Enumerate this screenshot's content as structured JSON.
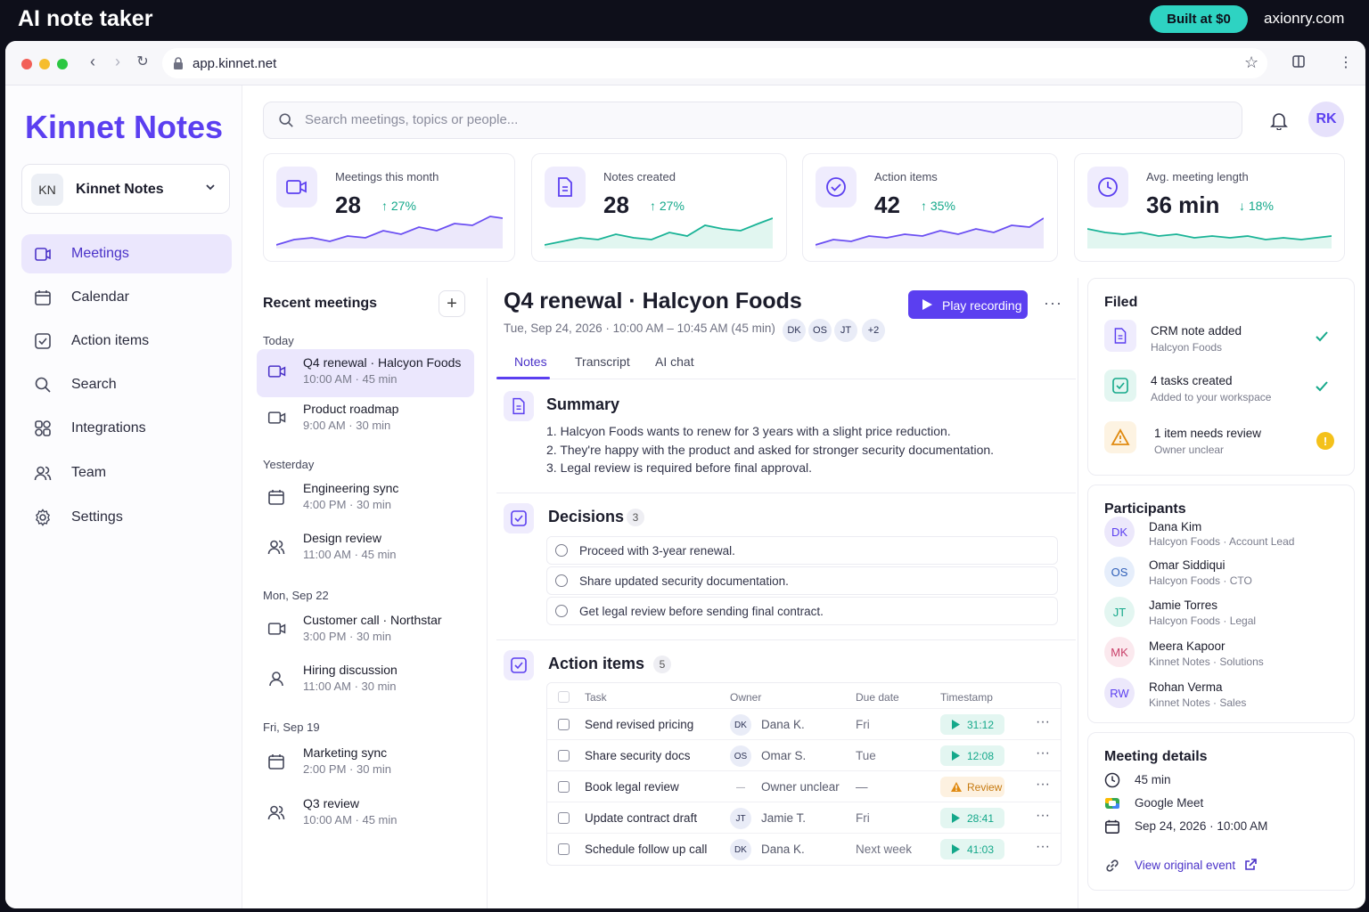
{
  "banner": {
    "title": "AI note taker",
    "pill": "Built at $0",
    "site": "axionry.com"
  },
  "browser": {
    "url": "app.kinnet.net"
  },
  "sidebar": {
    "brand": "Kinnet Notes",
    "workspace": {
      "initials": "KN",
      "name": "Kinnet Notes"
    },
    "items": [
      {
        "label": "Meetings",
        "icon": "meetings-icon"
      },
      {
        "label": "Calendar",
        "icon": "calendar-icon"
      },
      {
        "label": "Action items",
        "icon": "checkbox-icon"
      },
      {
        "label": "Search",
        "icon": "search-icon"
      },
      {
        "label": "Integrations",
        "icon": "integrations-icon"
      },
      {
        "label": "Team",
        "icon": "team-icon"
      },
      {
        "label": "Settings",
        "icon": "gear-icon"
      }
    ]
  },
  "header": {
    "search_placeholder": "Search meetings, topics or people...",
    "user_initials": "RK"
  },
  "stats": [
    {
      "label": "Meetings this month",
      "value": "28",
      "delta": "27%",
      "direction": "up",
      "icon": "video-icon"
    },
    {
      "label": "Notes created",
      "value": "28",
      "delta": "27%",
      "direction": "up",
      "icon": "document-icon"
    },
    {
      "label": "Action items",
      "value": "42",
      "delta": "35%",
      "direction": "up",
      "icon": "check-circle-icon"
    },
    {
      "label": "Avg. meeting length",
      "value": "36 min",
      "delta": "18%",
      "direction": "down",
      "icon": "clock-icon"
    }
  ],
  "recent": {
    "title": "Recent meetings",
    "add": "+",
    "groups": [
      {
        "label": "Today",
        "items": [
          {
            "name": "Q4 renewal · Halcyon Foods",
            "time": "10:00 AM · 45 min",
            "icon": "video-icon"
          },
          {
            "name": "Product roadmap",
            "time": "9:00 AM · 30 min",
            "icon": "video-icon"
          }
        ]
      },
      {
        "label": "Yesterday",
        "items": [
          {
            "name": "Engineering sync",
            "time": "4:00 PM · 30 min",
            "icon": "calendar-icon"
          },
          {
            "name": "Design review",
            "time": "11:00 AM · 45 min",
            "icon": "team-icon"
          }
        ]
      },
      {
        "label": "Mon, Sep 22",
        "items": [
          {
            "name": "Customer call · Northstar",
            "time": "3:00 PM · 30 min",
            "icon": "video-icon"
          },
          {
            "name": "Hiring discussion",
            "time": "11:00 AM · 30 min",
            "icon": "person-icon"
          }
        ]
      },
      {
        "label": "Fri, Sep 19",
        "items": [
          {
            "name": "Marketing sync",
            "time": "2:00 PM · 30 min",
            "icon": "calendar-icon"
          },
          {
            "name": "Q3 review",
            "time": "10:00 AM · 45 min",
            "icon": "team-icon"
          }
        ]
      }
    ]
  },
  "meeting": {
    "title": "Q4 renewal · Halcyon Foods",
    "subtitle": "Tue, Sep 24, 2026 · 10:00 AM – 10:45 AM (45 min)",
    "attendees": [
      "DK",
      "OS",
      "JT",
      "+2"
    ],
    "play_label": "Play recording",
    "more": "···",
    "tabs": [
      "Notes",
      "Transcript",
      "AI chat"
    ],
    "summary": {
      "title": "Summary",
      "items": [
        "1. Halcyon Foods wants to renew for 3 years with a slight price reduction.",
        "2. They're happy with the product and asked for stronger security documentation.",
        "3. Legal review is required before final approval."
      ]
    },
    "decisions": {
      "title": "Decisions",
      "count": "3",
      "items": [
        "Proceed with 3-year renewal.",
        "Share updated security documentation.",
        "Get legal review before sending final contract."
      ]
    },
    "action_items": {
      "title": "Action items",
      "count": "5",
      "columns": [
        "Task",
        "Owner",
        "Due date",
        "Timestamp"
      ],
      "rows": [
        {
          "task": "Send revised pricing",
          "owner_initials": "DK",
          "owner": "Dana K.",
          "due": "Fri",
          "timestamp": "31:12",
          "status": "ok"
        },
        {
          "task": "Share security docs",
          "owner_initials": "OS",
          "owner": "Omar S.",
          "due": "Tue",
          "timestamp": "12:08",
          "status": "ok"
        },
        {
          "task": "Book legal review",
          "owner_initials": "—",
          "owner": "Owner unclear",
          "due": "—",
          "timestamp": "Review",
          "status": "warn"
        },
        {
          "task": "Update contract draft",
          "owner_initials": "JT",
          "owner": "Jamie T.",
          "due": "Fri",
          "timestamp": "28:41",
          "status": "ok"
        },
        {
          "task": "Schedule follow up call",
          "owner_initials": "DK",
          "owner": "Dana K.",
          "due": "Next week",
          "timestamp": "41:03",
          "status": "ok"
        }
      ]
    }
  },
  "filed": {
    "title": "Filed",
    "items": [
      {
        "title": "CRM note added",
        "sub": "Halcyon Foods",
        "state": "done"
      },
      {
        "title": "4 tasks created",
        "sub": "Added to your workspace",
        "state": "done"
      },
      {
        "title": "1 item needs review",
        "sub": "Owner unclear",
        "state": "warn"
      }
    ]
  },
  "participants": {
    "title": "Participants",
    "people": [
      {
        "initials": "DK",
        "name": "Dana Kim",
        "role": "Halcyon Foods · Account Lead",
        "color": "#ece8fb",
        "fg": "#5b3ff0"
      },
      {
        "initials": "OS",
        "name": "Omar Siddiqui",
        "role": "Halcyon Foods · CTO",
        "color": "#e6eefb",
        "fg": "#2f5fb8"
      },
      {
        "initials": "JT",
        "name": "Jamie Torres",
        "role": "Halcyon Foods · Legal",
        "color": "#e3f6f1",
        "fg": "#14a88a"
      },
      {
        "initials": "MK",
        "name": "Meera Kapoor",
        "role": "Kinnet Notes · Solutions",
        "color": "#fbe9ee",
        "fg": "#c9406a"
      },
      {
        "initials": "RW",
        "name": "Rohan Verma",
        "role": "Kinnet Notes · Sales",
        "color": "#ece8fb",
        "fg": "#5b3ff0"
      }
    ]
  },
  "details": {
    "title": "Meeting details",
    "duration": "45 min",
    "platform": "Google Meet",
    "date": "Sep 24, 2026 · 10:00 AM",
    "link": "View original event"
  },
  "colors": {
    "accent": "#5b3ff0",
    "teal": "#14a88a",
    "warn": "#f0b400"
  }
}
